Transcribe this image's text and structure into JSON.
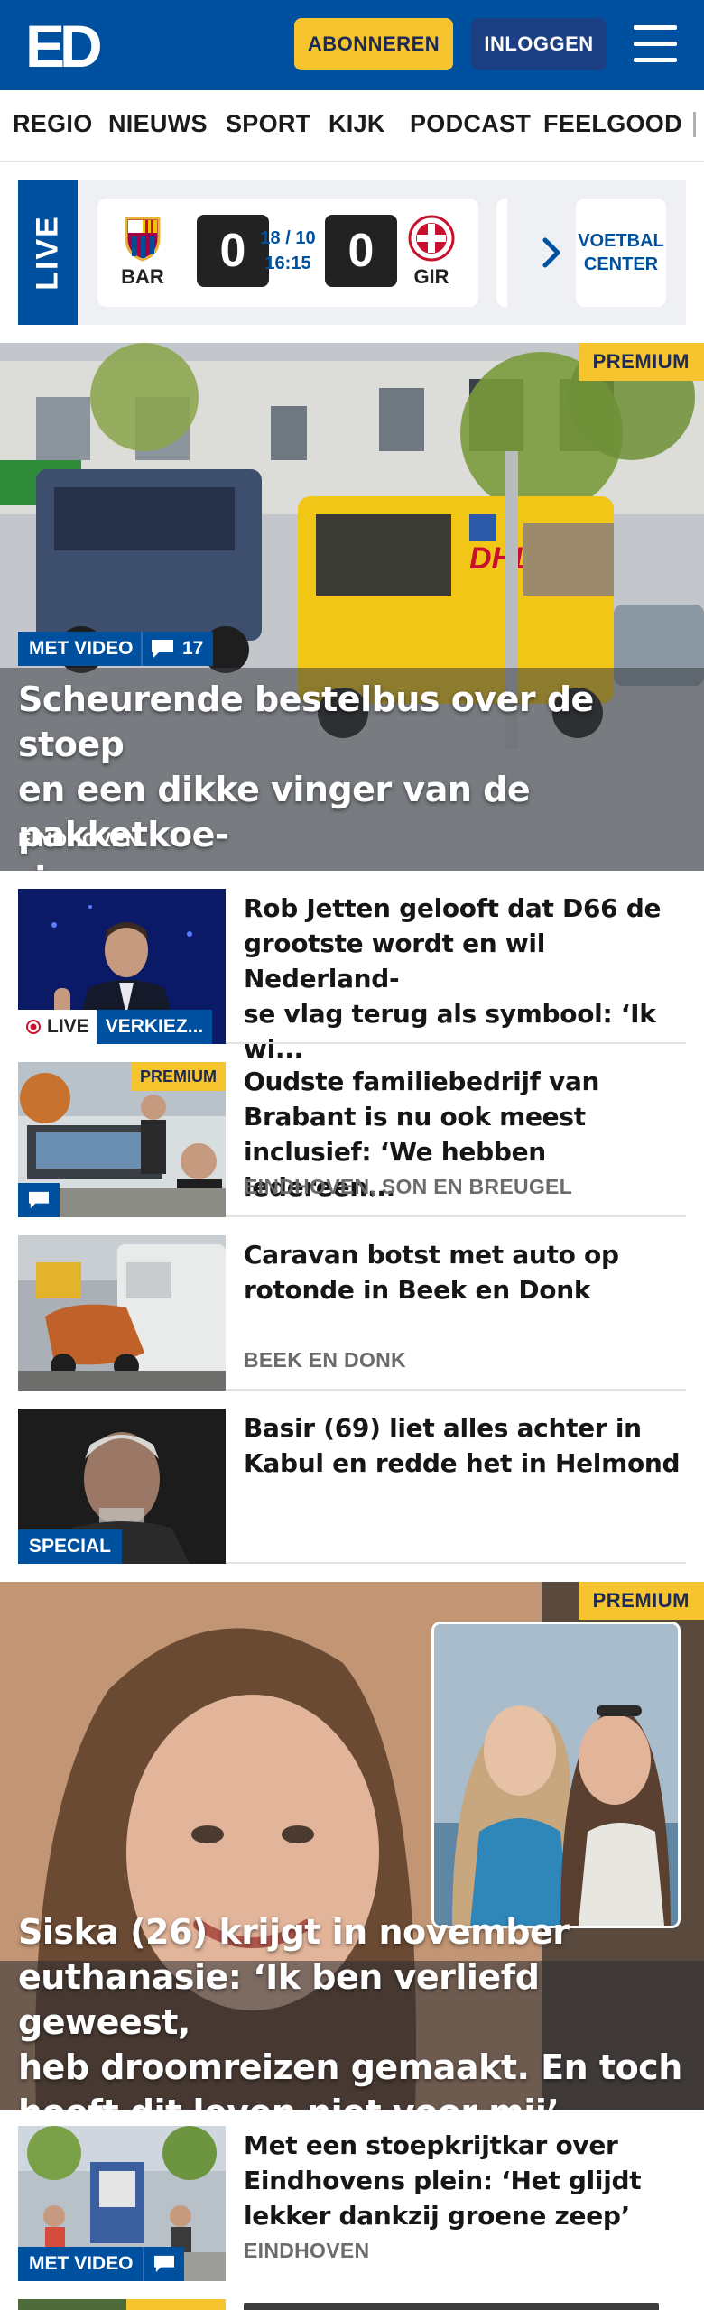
{
  "header": {
    "logo_text": "ED",
    "subscribe_label": "ABONNEREN",
    "login_label": "INLOGGEN",
    "colors": {
      "brand": "#0050a0",
      "accent": "#f5c42e"
    }
  },
  "nav": {
    "items": [
      "REGIO",
      "NIEUWS",
      "SPORT",
      "KIJK",
      "PODCAST",
      "FEELGOOD"
    ]
  },
  "live": {
    "label": "LIVE",
    "match": {
      "home_team": "BAR",
      "away_team": "GIR",
      "home_score": "0",
      "away_score": "0",
      "date": "18 / 10",
      "time": "16:15"
    },
    "voetbal_center_line1": "VOETBAL",
    "voetbal_center_line2": "CENTER"
  },
  "hero1": {
    "premium_label": "PREMIUM",
    "video_label": "MET VIDEO",
    "comment_count": "17",
    "title_lines": [
      "Scheurende bestelbus over de stoep",
      "en een dikke vinger van de pakketkoe-",
      "rier"
    ],
    "location": "EINDHOVEN"
  },
  "articles": [
    {
      "title_lines": [
        "Rob Jetten gelooft dat D66 de",
        "grootste wordt en wil Nederland-",
        "se vlag terug als symbool: ‘Ik wi..."
      ],
      "live_label": "LIVE",
      "tag_label": "VERKIEZ..."
    },
    {
      "title_lines": [
        "Oudste familiebedrijf van",
        "Brabant is nu ook meest",
        "inclusief: ‘We hebben iedereen..."
      ],
      "premium_label": "PREMIUM",
      "location": "EINDHOVEN, SON EN BREUGEL"
    },
    {
      "title_lines": [
        "Caravan botst met auto op",
        "rotonde in Beek en Donk"
      ],
      "location": "BEEK EN DONK"
    },
    {
      "title_lines": [
        "Basir (69) liet alles achter in",
        "Kabul en redde het in Helmond"
      ],
      "special_label": "SPECIAL"
    }
  ],
  "hero2": {
    "premium_label": "PREMIUM",
    "title_lines": [
      "Siska (26) krijgt in november",
      "euthanasie: ‘Ik ben verliefd geweest,",
      "heb droomreizen gemaakt. En toch",
      "hoeft dit leven niet voor mij’"
    ]
  },
  "article_last": {
    "title_lines": [
      "Met een stoepkrijtkar over",
      "Eindhovens plein: ‘Het glijdt",
      "lekker dankzij groene zeep’"
    ],
    "location": "EINDHOVEN",
    "video_label": "MET VIDEO"
  }
}
